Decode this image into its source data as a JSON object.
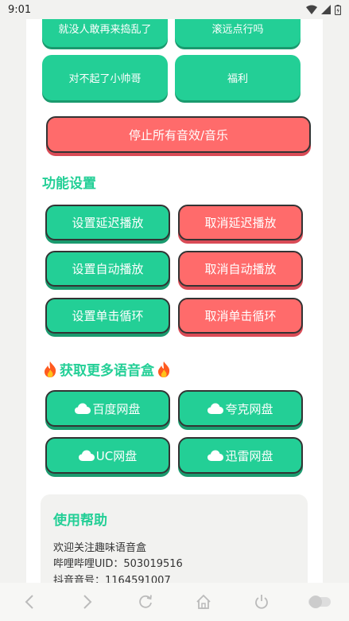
{
  "status_bar": {
    "time": "9:01"
  },
  "sounds": {
    "row1": [
      "就没人敢再来捣乱了",
      "滚远点行吗"
    ],
    "row2": [
      "对不起了小帅哥",
      "福利"
    ]
  },
  "stop_all_label": "停止所有音效/音乐",
  "settings": {
    "title": "功能设置",
    "delay_set": "设置延迟播放",
    "delay_cancel": "取消延迟播放",
    "auto_set": "设置自动播放",
    "auto_cancel": "取消自动播放",
    "loop_set": "设置单击循环",
    "loop_cancel": "取消单击循环"
  },
  "more": {
    "title": "获取更多语音盒",
    "title_icon": "fire-emoji",
    "links": [
      "百度网盘",
      "夸克网盘",
      "UC网盘",
      "迅雷网盘"
    ],
    "link_icon": "cloud-icon"
  },
  "help": {
    "title": "使用帮助",
    "lines": [
      "欢迎关注趣味语音盒",
      "哔哩哔哩UID：503019516",
      "抖音音号：1164591007"
    ]
  },
  "colors": {
    "accent": "#23cf96",
    "danger": "#ff6b6b",
    "background": "#f2f2f0"
  }
}
